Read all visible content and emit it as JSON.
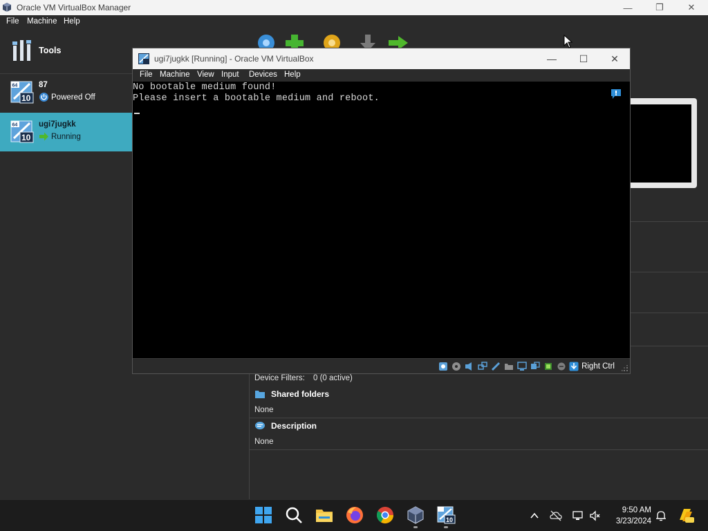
{
  "manager": {
    "title": "Oracle VM VirtualBox Manager",
    "menu": [
      "File",
      "Machine",
      "Help"
    ],
    "tools_label": "Tools",
    "vms": [
      {
        "name": "87",
        "state": "Powered Off",
        "icon": "windows10-64-vm-icon",
        "state_icon": "power-off-icon"
      },
      {
        "name": "ugi7jugkk",
        "state": "Running",
        "icon": "windows10-64-vm-icon",
        "state_icon": "running-arrow-icon",
        "selected": true
      }
    ],
    "details": {
      "device_filters_label": "Device Filters:",
      "device_filters_value": "0 (0 active)",
      "shared_folders_title": "Shared folders",
      "shared_folders_value": "None",
      "description_title": "Description",
      "description_value": "None"
    }
  },
  "vm_window": {
    "title": "ugi7jugkk [Running] - Oracle VM VirtualBox",
    "menu": [
      "File",
      "Machine",
      "View",
      "Input",
      "Devices",
      "Help"
    ],
    "console_lines": [
      "No bootable medium found!",
      "Please insert a bootable medium and reboot."
    ],
    "host_key": "Right Ctrl"
  },
  "taskbar": {
    "time": "9:50 AM",
    "date": "3/23/2024"
  },
  "colors": {
    "selected_row": "#3eaac0",
    "background": "#2b2b2b",
    "titlebar": "#f3f3f3"
  }
}
